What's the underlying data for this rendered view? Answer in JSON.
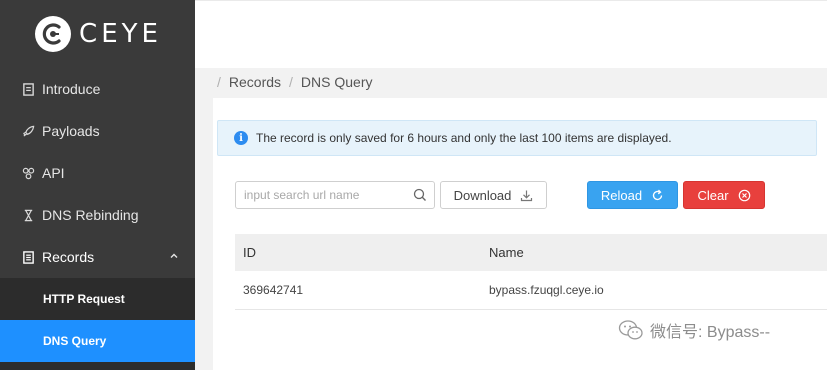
{
  "brand": {
    "name": "CEYE"
  },
  "sidebar": {
    "items": [
      {
        "label": "Introduce",
        "icon": "document-icon"
      },
      {
        "label": "Payloads",
        "icon": "rocket-icon"
      },
      {
        "label": "API",
        "icon": "api-icon"
      },
      {
        "label": "DNS Rebinding",
        "icon": "hourglass-icon"
      },
      {
        "label": "Records",
        "icon": "records-icon"
      }
    ],
    "subitems": [
      {
        "label": "HTTP Request"
      },
      {
        "label": "DNS Query"
      }
    ],
    "active_color": "#1e90ff"
  },
  "breadcrumb": {
    "items": [
      "Records",
      "DNS Query"
    ]
  },
  "alert": {
    "text": "The record is only saved for 6 hours and only the last 100 items are displayed."
  },
  "search": {
    "placeholder": "input search url name",
    "value": ""
  },
  "buttons": {
    "download": "Download",
    "reload": "Reload",
    "clear": "Clear"
  },
  "table": {
    "columns": [
      "ID",
      "Name"
    ],
    "rows": [
      {
        "id": "369642741",
        "name": "bypass.fzuqgl.ceye.io"
      }
    ]
  },
  "watermark": {
    "text": "微信号: Bypass--"
  }
}
